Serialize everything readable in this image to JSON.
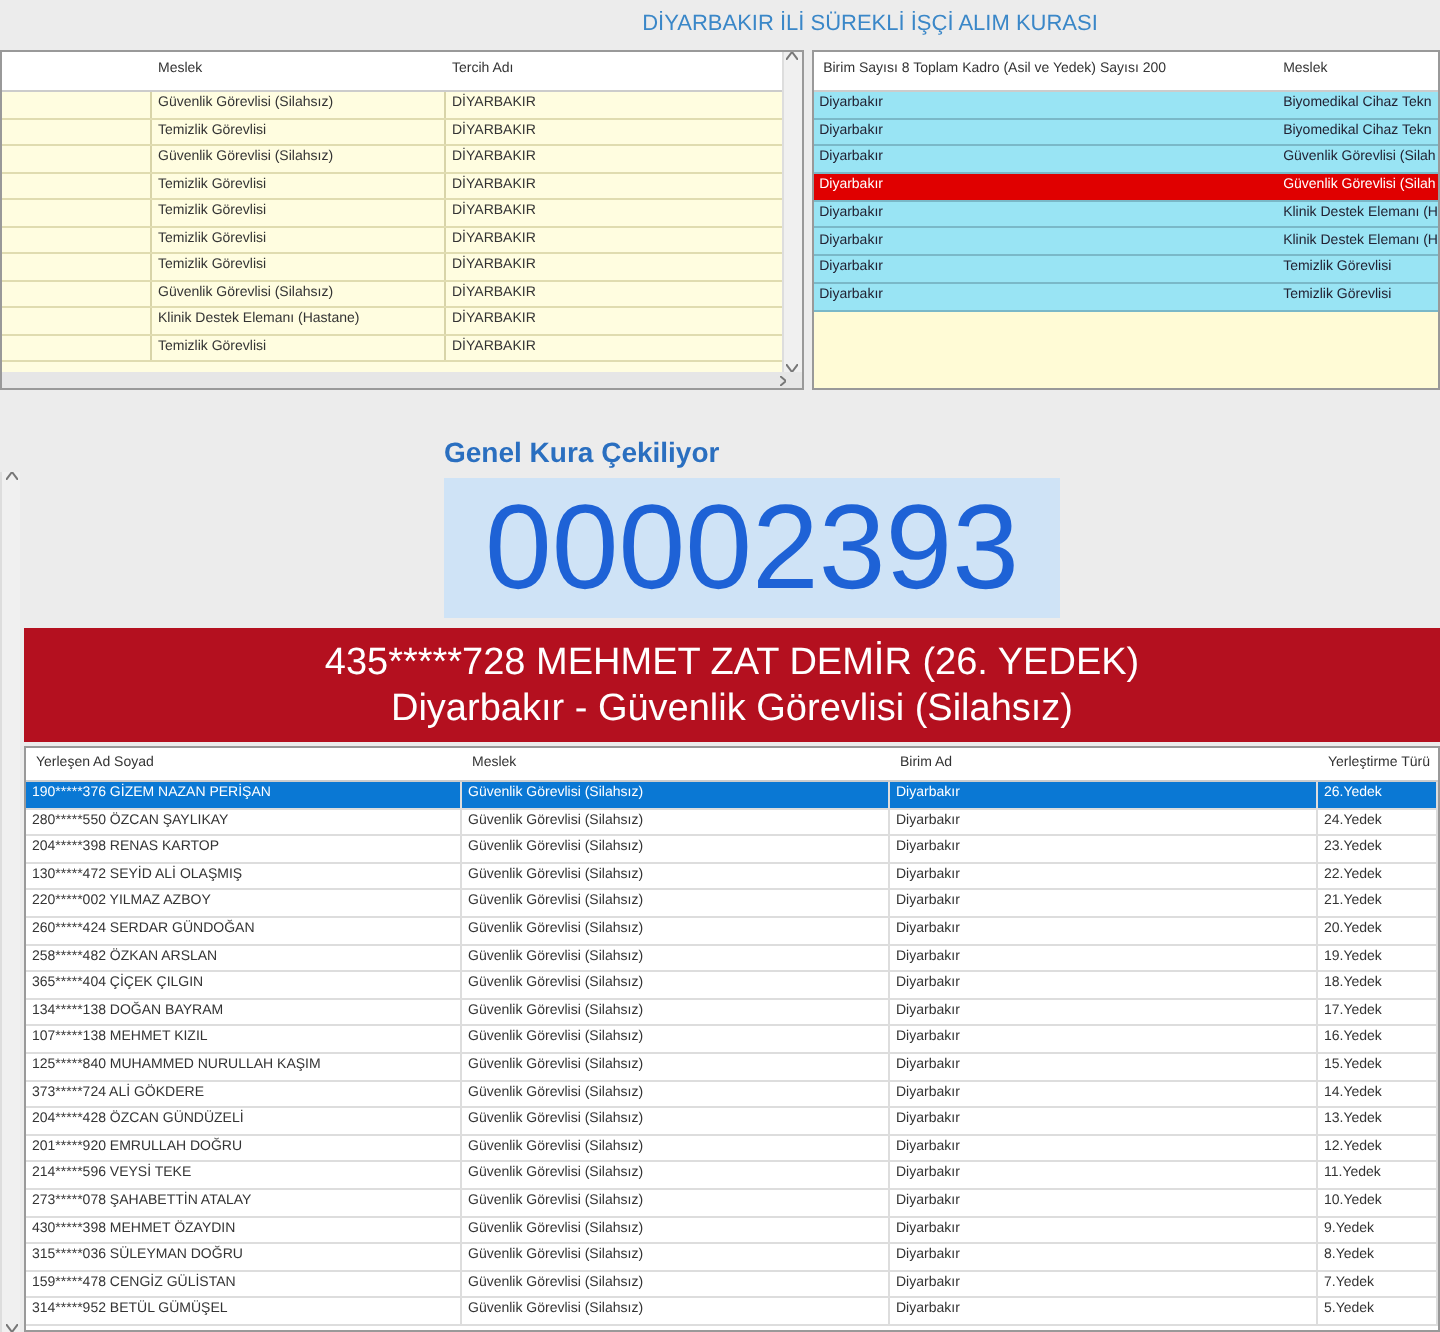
{
  "window": {
    "title": "DİYARBAKIR İLİ SÜREKLİ İŞÇİ ALIM KURASI"
  },
  "preferences_table": {
    "columns": [
      "Meslek",
      "Tercih Adı"
    ],
    "rows": [
      [
        "Güvenlik Görevlisi (Silahsız)",
        "DİYARBAKIR"
      ],
      [
        "Temizlik Görevlisi",
        "DİYARBAKIR"
      ],
      [
        "Güvenlik Görevlisi (Silahsız)",
        "DİYARBAKIR"
      ],
      [
        "Temizlik Görevlisi",
        "DİYARBAKIR"
      ],
      [
        "Temizlik Görevlisi",
        "DİYARBAKIR"
      ],
      [
        "Temizlik Görevlisi",
        "DİYARBAKIR"
      ],
      [
        "Temizlik Görevlisi",
        "DİYARBAKIR"
      ],
      [
        "Güvenlik Görevlisi (Silahsız)",
        "DİYARBAKIR"
      ],
      [
        "Klinik Destek Elemanı (Hastane)",
        "DİYARBAKIR"
      ],
      [
        "Temizlik Görevlisi",
        "DİYARBAKIR"
      ]
    ]
  },
  "units_table": {
    "columns": [
      "Birim Sayısı 8 Toplam Kadro (Asil ve Yedek) Sayısı 200",
      "Meslek"
    ],
    "rows": [
      {
        "cells": [
          "Diyarbakır",
          "Biyomedikal Cihaz Tekn"
        ],
        "selected": false
      },
      {
        "cells": [
          "Diyarbakır",
          "Biyomedikal Cihaz Tekn"
        ],
        "selected": false
      },
      {
        "cells": [
          "Diyarbakır",
          "Güvenlik Görevlisi (Silah"
        ],
        "selected": false
      },
      {
        "cells": [
          "Diyarbakır",
          "Güvenlik Görevlisi (Silah"
        ],
        "selected": true
      },
      {
        "cells": [
          "Diyarbakır",
          "Klinik Destek Elemanı (H"
        ],
        "selected": false
      },
      {
        "cells": [
          "Diyarbakır",
          "Klinik Destek Elemanı (H"
        ],
        "selected": false
      },
      {
        "cells": [
          "Diyarbakır",
          "Temizlik Görevlisi"
        ],
        "selected": false
      },
      {
        "cells": [
          "Diyarbakır",
          "Temizlik Görevlisi"
        ],
        "selected": false
      }
    ]
  },
  "draw": {
    "heading": "Genel Kura Çekiliyor",
    "number": "00002393",
    "winner_line": "435*****728 MEHMET ZAT DEMİR (26. YEDEK)",
    "placement_line": "Diyarbakır - Güvenlik Görevlisi (Silahsız)"
  },
  "results_table": {
    "columns": [
      "Yerleşen Ad Soyad",
      "Meslek",
      "Birim Ad",
      "Yerleştirme Türü"
    ],
    "rows": [
      {
        "cells": [
          "190*****376 GİZEM NAZAN PERİŞAN",
          "Güvenlik Görevlisi (Silahsız)",
          "Diyarbakır",
          "26.Yedek"
        ],
        "selected": true
      },
      {
        "cells": [
          "280*****550 ÖZCAN ŞAYLIKAY",
          "Güvenlik Görevlisi (Silahsız)",
          "Diyarbakır",
          "24.Yedek"
        ],
        "selected": false
      },
      {
        "cells": [
          "204*****398 RENAS KARTOP",
          "Güvenlik Görevlisi (Silahsız)",
          "Diyarbakır",
          "23.Yedek"
        ],
        "selected": false
      },
      {
        "cells": [
          "130*****472 SEYİD ALİ OLAŞMIŞ",
          "Güvenlik Görevlisi (Silahsız)",
          "Diyarbakır",
          "22.Yedek"
        ],
        "selected": false
      },
      {
        "cells": [
          "220*****002 YILMAZ AZBOY",
          "Güvenlik Görevlisi (Silahsız)",
          "Diyarbakır",
          "21.Yedek"
        ],
        "selected": false
      },
      {
        "cells": [
          "260*****424 SERDAR GÜNDOĞAN",
          "Güvenlik Görevlisi (Silahsız)",
          "Diyarbakır",
          "20.Yedek"
        ],
        "selected": false
      },
      {
        "cells": [
          "258*****482 ÖZKAN ARSLAN",
          "Güvenlik Görevlisi (Silahsız)",
          "Diyarbakır",
          "19.Yedek"
        ],
        "selected": false
      },
      {
        "cells": [
          "365*****404 ÇİÇEK ÇILGIN",
          "Güvenlik Görevlisi (Silahsız)",
          "Diyarbakır",
          "18.Yedek"
        ],
        "selected": false
      },
      {
        "cells": [
          "134*****138 DOĞAN BAYRAM",
          "Güvenlik Görevlisi (Silahsız)",
          "Diyarbakır",
          "17.Yedek"
        ],
        "selected": false
      },
      {
        "cells": [
          "107*****138 MEHMET KIZIL",
          "Güvenlik Görevlisi (Silahsız)",
          "Diyarbakır",
          "16.Yedek"
        ],
        "selected": false
      },
      {
        "cells": [
          "125*****840 MUHAMMED NURULLAH KAŞIM",
          "Güvenlik Görevlisi (Silahsız)",
          "Diyarbakır",
          "15.Yedek"
        ],
        "selected": false
      },
      {
        "cells": [
          "373*****724 ALİ GÖKDERE",
          "Güvenlik Görevlisi (Silahsız)",
          "Diyarbakır",
          "14.Yedek"
        ],
        "selected": false
      },
      {
        "cells": [
          "204*****428 ÖZCAN GÜNDÜZELİ",
          "Güvenlik Görevlisi (Silahsız)",
          "Diyarbakır",
          "13.Yedek"
        ],
        "selected": false
      },
      {
        "cells": [
          "201*****920 EMRULLAH DOĞRU",
          "Güvenlik Görevlisi (Silahsız)",
          "Diyarbakır",
          "12.Yedek"
        ],
        "selected": false
      },
      {
        "cells": [
          "214*****596 VEYSİ TEKE",
          "Güvenlik Görevlisi (Silahsız)",
          "Diyarbakır",
          "11.Yedek"
        ],
        "selected": false
      },
      {
        "cells": [
          "273*****078 ŞAHABETTİN ATALAY",
          "Güvenlik Görevlisi (Silahsız)",
          "Diyarbakır",
          "10.Yedek"
        ],
        "selected": false
      },
      {
        "cells": [
          "430*****398 MEHMET ÖZAYDIN",
          "Güvenlik Görevlisi (Silahsız)",
          "Diyarbakır",
          "9.Yedek"
        ],
        "selected": false
      },
      {
        "cells": [
          "315*****036 SÜLEYMAN DOĞRU",
          "Güvenlik Görevlisi (Silahsız)",
          "Diyarbakır",
          "8.Yedek"
        ],
        "selected": false
      },
      {
        "cells": [
          "159*****478 CENGİZ GÜLİSTAN",
          "Güvenlik Görevlisi (Silahsız)",
          "Diyarbakır",
          "7.Yedek"
        ],
        "selected": false
      },
      {
        "cells": [
          "314*****952 BETÜL GÜMÜŞEL",
          "Güvenlik Görevlisi (Silahsız)",
          "Diyarbakır",
          "5.Yedek"
        ],
        "selected": false
      }
    ]
  }
}
